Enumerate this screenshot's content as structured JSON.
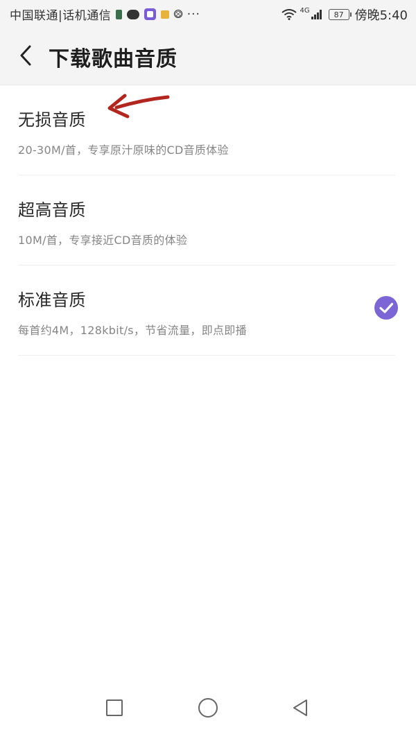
{
  "status_bar": {
    "carrier": "中国联通|话机通信",
    "network_tag": "4G",
    "battery": "87",
    "time": "傍晚5:40"
  },
  "header": {
    "title": "下载歌曲音质"
  },
  "options": [
    {
      "title": "无损音质",
      "desc": "20-30M/首，专享原汁原味的CD音质体验",
      "selected": false
    },
    {
      "title": "超高音质",
      "desc": "10M/首，专享接近CD音质的体验",
      "selected": false
    },
    {
      "title": "标准音质",
      "desc": "每首约4M，128kbit/s，节省流量，即点即播",
      "selected": true
    }
  ],
  "colors": {
    "accent": "#7c66d6",
    "annotation": "#b3261e"
  }
}
